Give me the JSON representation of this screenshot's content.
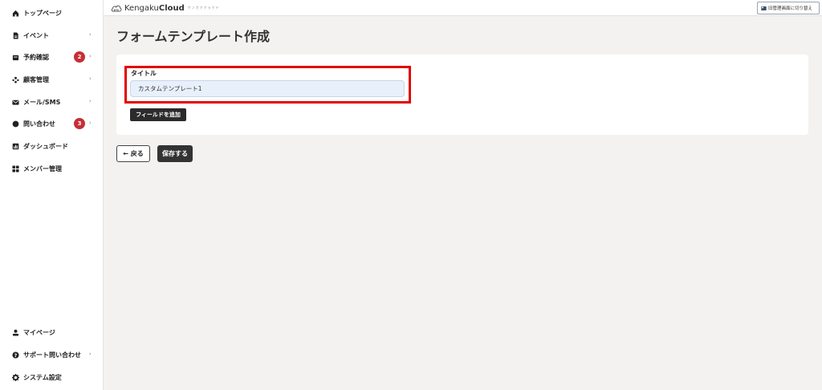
{
  "sidebar": {
    "top_items": [
      {
        "label": "トップページ",
        "icon": "home-icon"
      },
      {
        "label": "イベント",
        "icon": "document-icon",
        "chevron": "›"
      },
      {
        "label": "予約確認",
        "icon": "inbox-icon",
        "badge": "2",
        "chevron": "›"
      },
      {
        "label": "顧客管理",
        "icon": "users-icon",
        "chevron": "›"
      },
      {
        "label": "メール/SMS",
        "icon": "mail-icon",
        "chevron": "›"
      },
      {
        "label": "問い合わせ",
        "icon": "chat-icon",
        "badge": "3",
        "chevron": "›"
      },
      {
        "label": "ダッシュボード",
        "icon": "chart-icon"
      },
      {
        "label": "メンバー管理",
        "icon": "grid-icon"
      }
    ],
    "bottom_items": [
      {
        "label": "マイページ",
        "icon": "user-icon"
      },
      {
        "label": "サポート問い合わせ",
        "icon": "help-icon",
        "chevron": "›"
      },
      {
        "label": "システム設定",
        "icon": "gear-icon"
      }
    ]
  },
  "header": {
    "logo_text_light": "Kengaku",
    "logo_text_bold": "Cloud",
    "logo_sub": "ケンガククラウド",
    "switch_label": "旧管理画面に切り替え"
  },
  "main": {
    "page_title": "フォームテンプレート作成",
    "title_label": "タイトル",
    "title_value": "カスタムテンプレート1",
    "add_field_label": "フィールドを追加",
    "back_label": "← 戻る",
    "save_label": "保存する"
  },
  "colors": {
    "badge": "#c62f36",
    "highlight": "#e20000",
    "input_bg": "#e8f0fb",
    "dark_button": "#333333"
  }
}
